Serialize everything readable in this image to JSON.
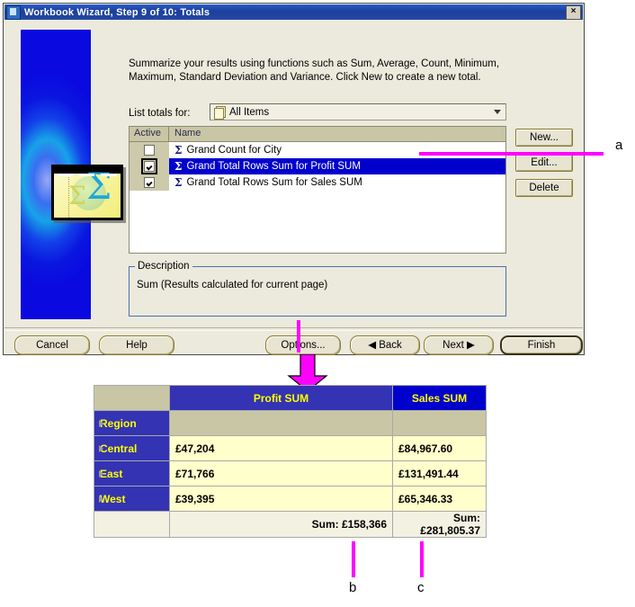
{
  "dialog": {
    "title": "Workbook Wizard, Step 9 of 10: Totals",
    "close_label": "×",
    "intro": "Summarize your results using functions such as Sum, Average, Count, Minimum, Maximum, Standard Deviation and Variance. Click New to create a new total.",
    "list_totals_label": "List totals for:",
    "combo_value": "All Items",
    "list_headers": {
      "active": "Active",
      "name": "Name"
    },
    "list_rows": [
      {
        "name": "Grand Count for City",
        "checked": false,
        "selected": false
      },
      {
        "name": "Grand Total Rows Sum for Profit SUM",
        "checked": true,
        "selected": true
      },
      {
        "name": "Grand Total Rows Sum for Sales SUM",
        "checked": true,
        "selected": false
      }
    ],
    "side_buttons": {
      "new": "New...",
      "edit": "Edit...",
      "delete": "Delete"
    },
    "description_group_title": "Description",
    "description_text": "Sum (Results calculated for current page)",
    "bottom_buttons": {
      "cancel": "Cancel",
      "help": "Help",
      "options": "Options...",
      "back": "◀ Back",
      "next": "Next ▶",
      "finish": "Finish"
    },
    "banner_symbol": "Σ"
  },
  "annotations": {
    "a": "a",
    "b": "b",
    "c": "c"
  },
  "result_table": {
    "corner": "",
    "columns": [
      "Profit SUM",
      "Sales SUM"
    ],
    "region_label": "Region",
    "rows": [
      {
        "label": "Central",
        "profit": "£47,204",
        "sales": "£84,967.60"
      },
      {
        "label": "East",
        "profit": "£71,766",
        "sales": "£131,491.44"
      },
      {
        "label": "West",
        "profit": "£39,395",
        "sales": "£65,346.33"
      }
    ],
    "footer": {
      "profit": "Sum: £158,366",
      "sales": "Sum: £281,805.37"
    }
  },
  "colors": {
    "accent_magenta": "#ff00ff",
    "header_profit": "#3333b3",
    "header_sales": "#0000cc",
    "header_text": "#ffff00",
    "value_bg": "#ffffcc",
    "titlebar": "#1b3f9e",
    "dialog_bg": "#eceadc"
  }
}
